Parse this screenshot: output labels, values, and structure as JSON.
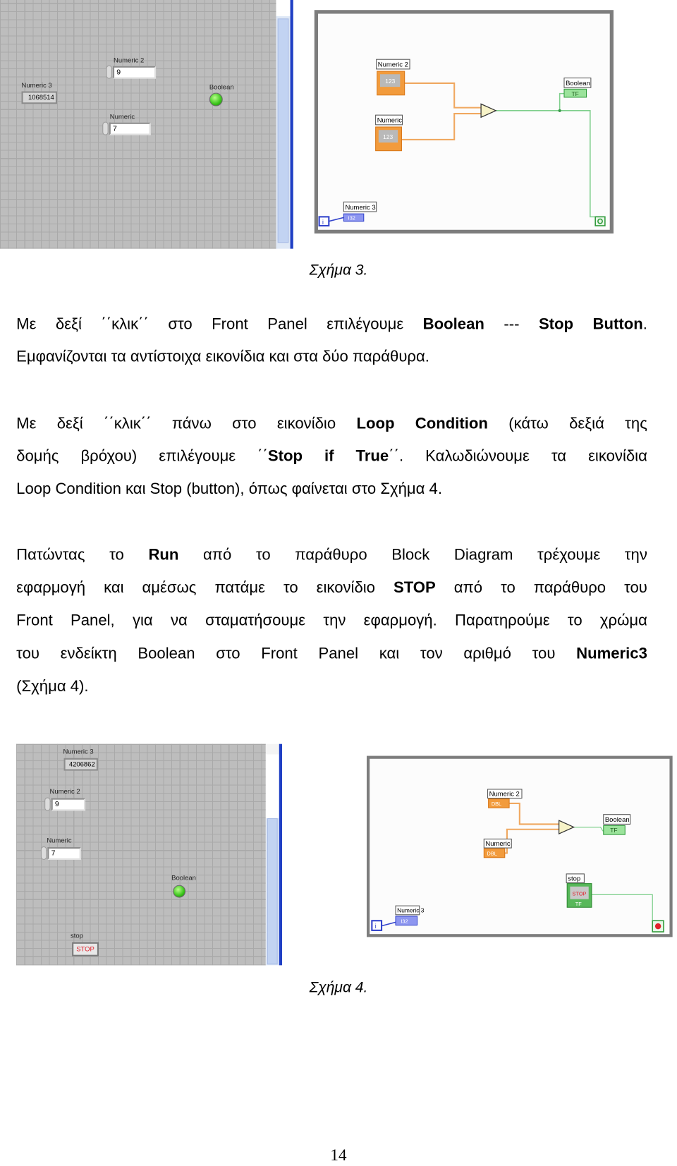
{
  "figure3": {
    "front_panel": {
      "numeric2": {
        "label": "Numeric 2",
        "value": "9"
      },
      "numeric3": {
        "label": "Numeric 3",
        "value": "1068514"
      },
      "numeric": {
        "label": "Numeric",
        "value": "7"
      },
      "boolean": {
        "label": "Boolean",
        "state": "on",
        "color": "#39c41a"
      }
    },
    "block_diagram": {
      "numeric2_label": "Numeric 2",
      "numeric_label": "Numeric",
      "boolean_label": "Boolean",
      "numeric3_label": "Numeric 3",
      "numeric_terminal": "123",
      "int_terminal": "I32",
      "bool_terminal": "TF",
      "iteration": "i",
      "compare_function": "greater-or-equal-icon"
    },
    "caption": "Σχήμα 3."
  },
  "paragraphs": {
    "p1": {
      "l1": [
        "Με δεξί ΄΄κλικ΄΄ στο Front Panel επιλέγουμε ",
        "Boolean",
        " --- ",
        "Stop Button",
        "."
      ],
      "l2": "Εμφανίζονται τα αντίστοιχα εικονίδια και στα δύο παράθυρα."
    },
    "p2": {
      "l1": [
        " Με δεξί ΄΄κλικ΄΄ πάνω στο εικονίδιο ",
        "Loop Condition",
        " (κάτω δεξιά της"
      ],
      "l2": [
        "δομής βρόχου) επιλέγουμε ΄΄",
        "Stop if True",
        "΄΄. Καλωδιώνουμε τα εικονίδια"
      ],
      "l3": "Loop Condition και Stop (button), όπως φαίνεται στο Σχήμα 4."
    },
    "p3": {
      "l1": [
        "Πατώντας το ",
        "Run",
        " από το παράθυρο Block Diagram τρέχουμε την"
      ],
      "l2": [
        "εφαρμογή και αμέσως πατάμε το εικονίδιο ",
        "STOP",
        " από το παράθυρο του"
      ],
      "l3": "Front Panel, για να σταματήσουμε την εφαρμογή. Παρατηρούμε το χρώμα",
      "l4": [
        "του ενδείκτη Boolean στο Front Panel και τον αριθμό του ",
        "Numeric3"
      ],
      "l5": "(Σχήμα 4)."
    }
  },
  "figure4": {
    "front_panel": {
      "numeric3": {
        "label": "Numeric 3",
        "value": "4206862"
      },
      "numeric2": {
        "label": "Numeric 2",
        "value": "9"
      },
      "numeric": {
        "label": "Numeric",
        "value": "7"
      },
      "boolean": {
        "label": "Boolean",
        "state": "on",
        "color": "#39c41a"
      },
      "stop": {
        "label": "stop",
        "button": "STOP"
      }
    },
    "block_diagram": {
      "numeric2_label": "Numeric 2",
      "numeric_label": "Numeric",
      "boolean_label": "Boolean",
      "stop_label": "stop",
      "stop_terminal": "STOP",
      "numeric3_label": "Numeric 3",
      "dbl_terminal": "DBL",
      "int_terminal": "I32",
      "bool_terminal": "TF",
      "iteration": "i",
      "loop_condition": "stop-if-true-icon"
    },
    "caption": "Σχήμα 4."
  },
  "page_number": "14"
}
